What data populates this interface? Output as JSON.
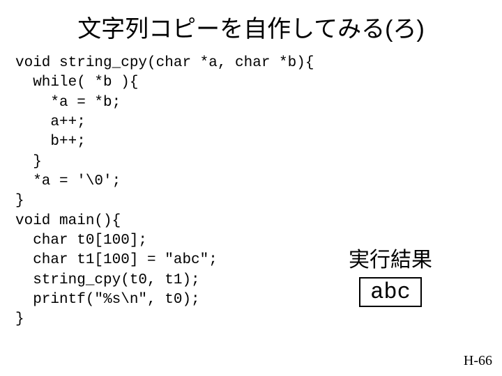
{
  "title": "文字列コピーを自作してみる(ろ)",
  "code": "void string_cpy(char *a, char *b){\n  while( *b ){\n    *a = *b;\n    a++;\n    b++;\n  }\n  *a = '\\0';\n}\nvoid main(){\n  char t0[100];\n  char t1[100] = \"abc\";\n  string_cpy(t0, t1);\n  printf(\"%s\\n\", t0);\n}",
  "result": {
    "label": "実行結果",
    "output": "abc"
  },
  "pagenum": "H-66"
}
